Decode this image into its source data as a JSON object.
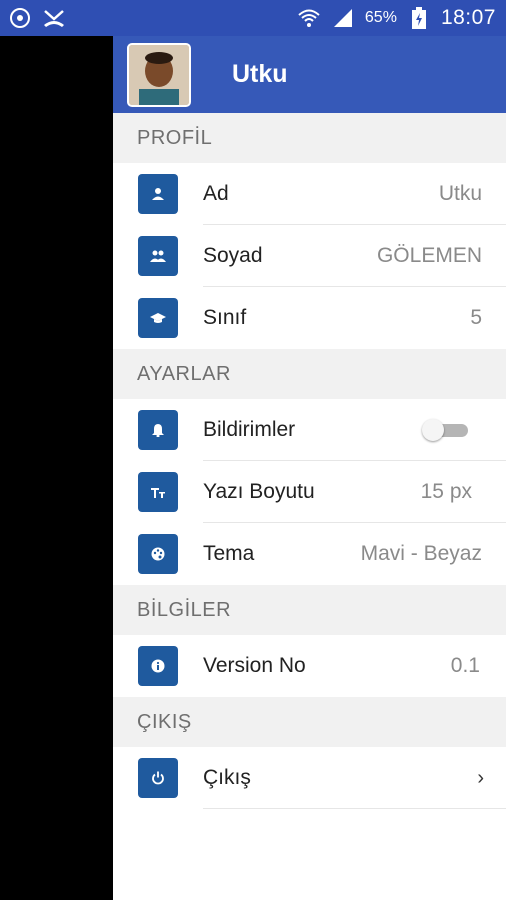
{
  "status_bar": {
    "battery_percent": "65%",
    "time": "18:07"
  },
  "header": {
    "name": "Utku"
  },
  "sections": {
    "profil": {
      "title": "PROFİL",
      "ad": {
        "label": "Ad",
        "value": "Utku",
        "icon": "person-icon"
      },
      "soyad": {
        "label": "Soyad",
        "value": "GÖLEMEN",
        "icon": "group-icon"
      },
      "sinif": {
        "label": "Sınıf",
        "value": "5",
        "icon": "graduation-cap-icon"
      }
    },
    "ayarlar": {
      "title": "AYARLAR",
      "bildirimler": {
        "label": "Bildirimler",
        "toggle_on": false,
        "icon": "bell-icon"
      },
      "yazi_boyutu": {
        "label": "Yazı Boyutu",
        "value": "15 px",
        "icon": "text-size-icon"
      },
      "tema": {
        "label": "Tema",
        "value": "Mavi - Beyaz",
        "icon": "palette-icon"
      }
    },
    "bilgiler": {
      "title": "BİLGİLER",
      "version": {
        "label": "Version No",
        "value": "0.1",
        "icon": "info-icon"
      }
    },
    "cikis": {
      "title": "ÇIKIŞ",
      "logout": {
        "label": "Çıkış",
        "arrow": "›",
        "icon": "power-icon"
      }
    }
  },
  "colors": {
    "status_bar": "#2f4fb3",
    "header": "#3659b8",
    "icon_bg": "#1f5a9e",
    "section_bg": "#f1f1f1"
  }
}
